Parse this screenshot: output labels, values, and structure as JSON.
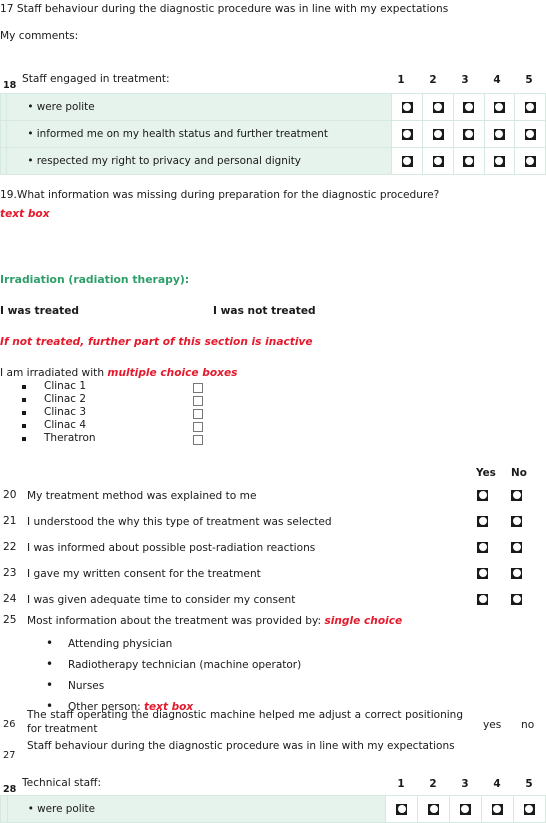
{
  "document": {
    "q17": "17 Staff behaviour during the diagnostic procedure was in line with my expectations",
    "comments_label": "My comments:"
  },
  "question18": {
    "number": "18",
    "title": "Staff engaged in treatment:",
    "scale_headers": [
      "1",
      "2",
      "3",
      "4",
      "5"
    ],
    "rows": [
      "• were polite",
      "• informed me on my health status and further treatment",
      "• respected my right to privacy and personal dignity"
    ]
  },
  "question19": {
    "text": "19.What information was missing during preparation for the diagnostic procedure?",
    "hint": "text box"
  },
  "irradiation": {
    "heading": "Irradiation (radiation therapy):",
    "treated_label": "I was treated",
    "not_treated_label": "I was not treated",
    "inactive_note": "If not treated, further part of this section is inactive",
    "irradiated_prefix": "I am irradiated with ",
    "irradiated_hint": "multiple choice boxes",
    "machines": [
      "Clinac 1",
      "Clinac 2",
      "Clinac 3",
      "Clinac 4",
      "Theratron"
    ]
  },
  "yesno": {
    "yes_header": "Yes",
    "no_header": "No",
    "questions": [
      {
        "number": "20",
        "text": "My treatment method was explained to me"
      },
      {
        "number": "21",
        "text": "I understood the why this type of treatment was selected"
      },
      {
        "number": "22",
        "text": "I was informed about possible post-radiation reactions"
      },
      {
        "number": "23",
        "text": "I gave my written consent for the treatment"
      },
      {
        "number": "24",
        "text": "I was given adequate time to consider my consent"
      }
    ]
  },
  "question25": {
    "number": "25",
    "text_prefix": "Most information about the treatment was provided by: ",
    "hint": "single choice",
    "options": [
      {
        "label": "Attending physician",
        "hint": ""
      },
      {
        "label": "Radiotherapy technician (machine operator)",
        "hint": ""
      },
      {
        "label": "Nurses",
        "hint": ""
      },
      {
        "label": "Other person: ",
        "hint": "text box"
      }
    ]
  },
  "question26": {
    "number": "26",
    "text": "The staff operating the diagnostic machine helped me adjust a correct positioning for treatment",
    "yes_label": "yes",
    "no_label": "no"
  },
  "question27": {
    "number": "27",
    "text": "Staff behaviour during the diagnostic procedure was in line with my expectations"
  },
  "question28": {
    "number": "28",
    "title": "Technical staff:",
    "scale_headers": [
      "1",
      "2",
      "3",
      "4",
      "5"
    ],
    "rows": [
      "• were polite"
    ]
  },
  "colors": {
    "accent_green": "#2e9e6b",
    "table_tint": "#e6f2ec",
    "table_border": "#d6e9e0",
    "hint_red": "#e4192c"
  }
}
